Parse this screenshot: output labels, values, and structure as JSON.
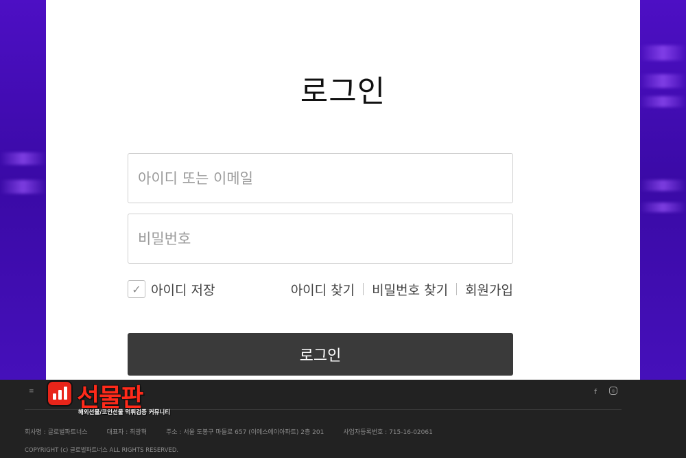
{
  "login": {
    "title": "로그인",
    "id_placeholder": "아이디 또는 이메일",
    "password_placeholder": "비밀번호",
    "remember_label": "아이디 저장",
    "checkbox_mark": "✓",
    "find_id": "아이디 찾기",
    "find_password": "비밀번호 찾기",
    "signup": "회원가입",
    "submit_label": "로그인"
  },
  "footer": {
    "company": "회사명 : 글로벌파트너스",
    "ceo": "대표자 : 최광혁",
    "address": "주소 : 서울 도봉구 마들로 657 (이에스에이아파트) 2층 201",
    "business_no": "사업자등록번호 : 715-16-02061",
    "copyright": "COPYRIGHT (c) 글로벌파트너스 ALL RIGHTS RESERVED.",
    "social": {
      "facebook": "f",
      "instagram": "◎"
    },
    "small_icon": "≡"
  },
  "logo": {
    "text": "선물판",
    "subtitle": "해외선물/코인선물 먹튀검증 커뮤니티"
  },
  "colors": {
    "background": "#4d0fc4",
    "button": "#3a3a3a",
    "footer": "#222222",
    "logo_red": "#e8251a"
  }
}
